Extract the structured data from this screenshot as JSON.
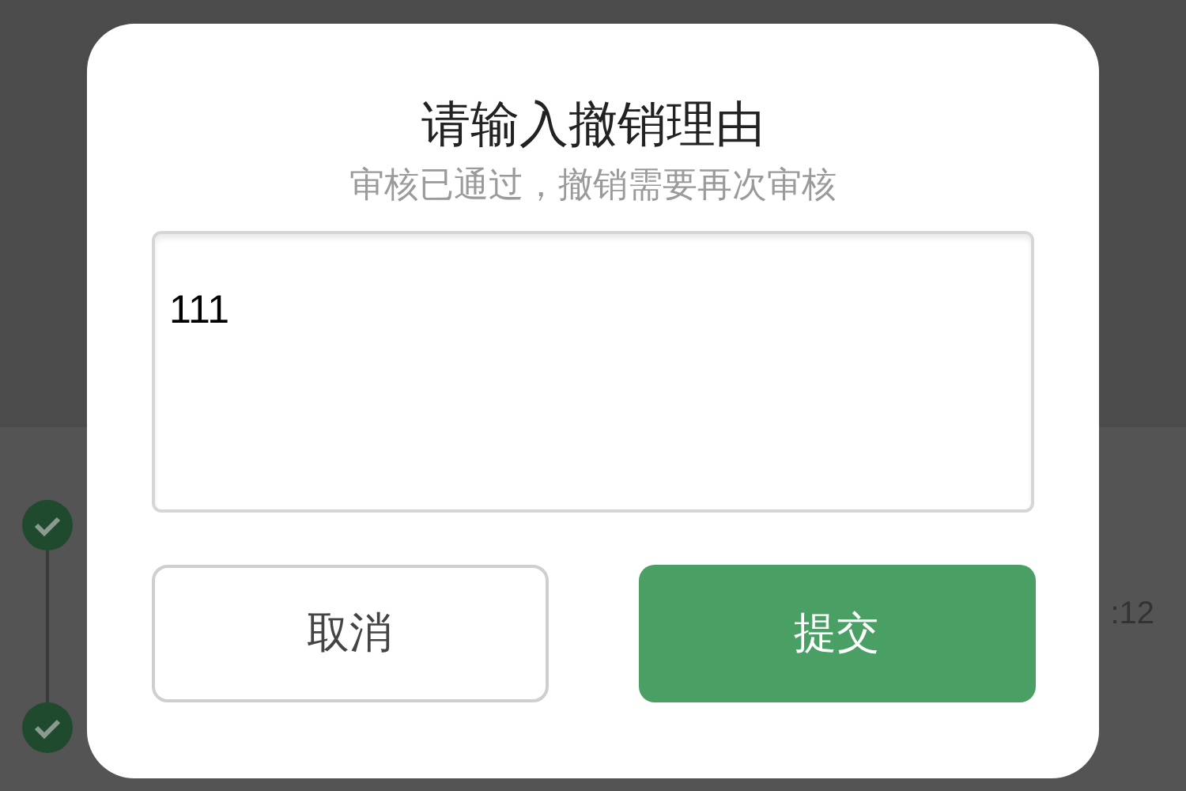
{
  "background": {
    "time_partial": ":12",
    "steps": [
      {
        "done": true
      },
      {
        "done": true
      }
    ]
  },
  "dialog": {
    "title": "请输入撤销理由",
    "subtitle": "审核已通过，撤销需要再次审核",
    "reason_field": {
      "value": "111"
    },
    "buttons": [
      {
        "label": "取消",
        "kind": "secondary"
      },
      {
        "label": "提交",
        "kind": "primary"
      }
    ]
  }
}
